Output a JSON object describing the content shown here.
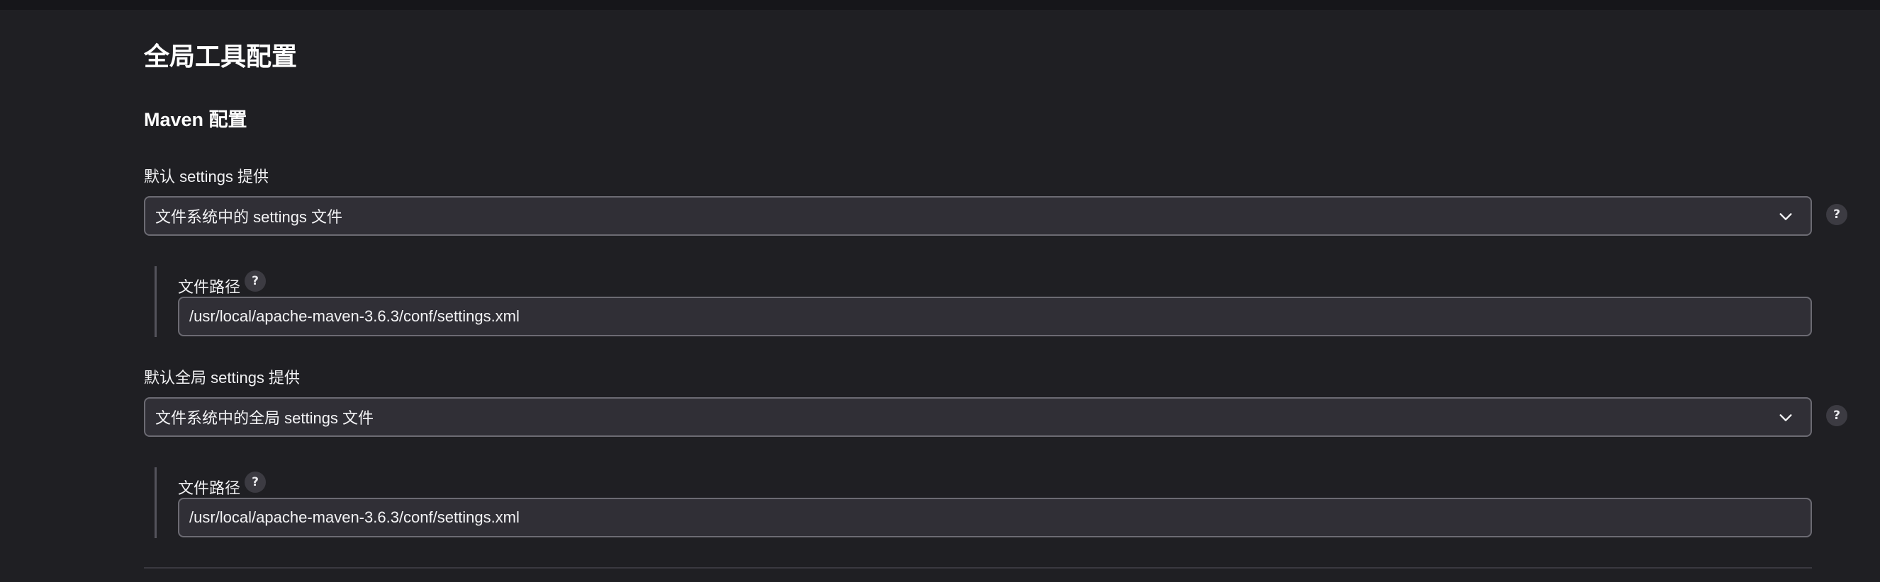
{
  "page": {
    "title": "全局工具配置"
  },
  "maven": {
    "section_title": "Maven 配置",
    "settings": {
      "label": "默认 settings 提供",
      "selected": "文件系统中的 settings 文件",
      "path_label": "文件路径",
      "path_value": "/usr/local/apache-maven-3.6.3/conf/settings.xml"
    },
    "global_settings": {
      "label": "默认全局 settings 提供",
      "selected": "文件系统中的全局 settings 文件",
      "path_label": "文件路径",
      "path_value": "/usr/local/apache-maven-3.6.3/conf/settings.xml"
    },
    "help_glyph": "?"
  },
  "icons": {
    "dropdown": "chevron-down-icon",
    "help": "help-icon"
  },
  "colors": {
    "background": "#1f1f23",
    "field_background": "#302f36",
    "field_border": "#6c6b73",
    "text": "#f3f3f5"
  }
}
